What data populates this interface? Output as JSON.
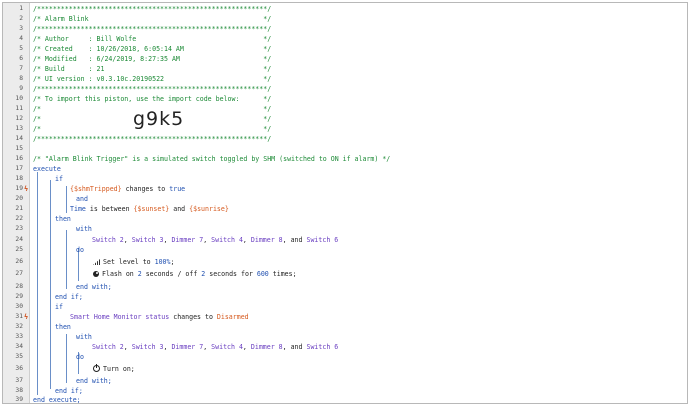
{
  "line_numbers": [
    "1",
    "2",
    "3",
    "4",
    "5",
    "6",
    "7",
    "8",
    "9",
    "10",
    "11",
    "12",
    "13",
    "14",
    "15",
    "16",
    "17",
    "18",
    "19",
    "20",
    "21",
    "22",
    "23",
    "24",
    "25",
    "26",
    "27",
    "28",
    "29",
    "30",
    "31",
    "32",
    "33",
    "34",
    "35",
    "36",
    "37",
    "38",
    "39"
  ],
  "trigger_icon": "lightning-icon",
  "header": {
    "l1": "/**********************************************************/",
    "l2": "/* Alarm Blink                                            */",
    "l3": "/**********************************************************/",
    "l4": "/* Author     : Bill Wolfe                                */",
    "l5": "/* Created    : 10/26/2018, 6:05:14 AM                    */",
    "l6": "/* Modified   : 6/24/2019, 8:27:35 AM                     */",
    "l7": "/* Build      : 21                                        */",
    "l8": "/* UI version : v0.3.10c.20190522                         */",
    "l9": "/**********************************************************/",
    "l10": "/* To import this piston, use the import code below:      */",
    "l11": "/*                                                        */",
    "l12": "/*                                                        */",
    "l13": "/*                                                        */",
    "l14": "/**********************************************************/",
    "import_code": "g9k5"
  },
  "comment16": "/* \"Alarm Blink Trigger\" is a simulated switch toggled by SHM (switched to ON if alarm) */",
  "kw": {
    "execute": "execute",
    "if": "if",
    "and": "and",
    "then": "then",
    "with": "with",
    "do": "do",
    "end_with": "end with;",
    "end_if": "end if;",
    "end_execute": "end execute;"
  },
  "cond1": {
    "var": "{$shmTripped}",
    "op": " changes to ",
    "val": "true"
  },
  "cond2": {
    "subject": "Time",
    "op": " is between ",
    "v1": "{$sunset}",
    "and": " and ",
    "v2": "{$sunrise}"
  },
  "devices": {
    "s2": "Switch 2",
    "s3": "Switch 3",
    "d7": "Dimmer 7",
    "s4": "Switch 4",
    "d8": "Dimmer 8",
    "s6": "Switch 6",
    "sep": ", ",
    "and": ", and "
  },
  "action1": {
    "pre": "Set level to ",
    "val": "100%",
    "post": ";"
  },
  "action2": {
    "pre": "Flash on ",
    "a": "2",
    "m1": " seconds / off ",
    "b": "2",
    "m2": " seconds for ",
    "c": "600",
    "post": " times;"
  },
  "cond3": {
    "subject": "Smart Home Monitor status",
    "op": " changes to ",
    "val": "Disarmed"
  },
  "action3": "Turn on;",
  "colors": {
    "comment": "#1c8a36",
    "keyword": "#1f4fb0",
    "variable": "#d65a1f",
    "device": "#6a3fc1",
    "gutter": "#ececec"
  }
}
